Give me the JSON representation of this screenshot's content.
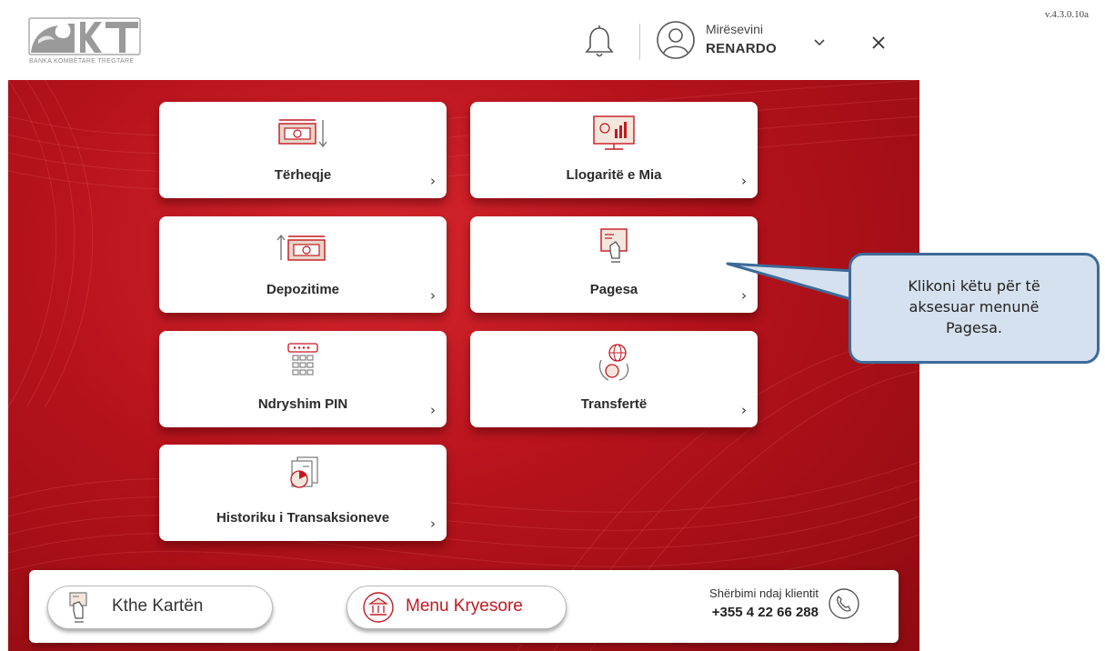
{
  "header": {
    "logo_text": "BKT",
    "logo_subtitle": "BANKA KOMBËTARE TREGTARE",
    "version": "v.4.3.0.10a",
    "greeting": "Mirësevini",
    "username": "RENARDO"
  },
  "menu": [
    {
      "label": "Tërheqje",
      "icon": "cash-withdraw-icon"
    },
    {
      "label": "Llogaritë e Mia",
      "icon": "accounts-monitor-icon"
    },
    {
      "label": "Depozitime",
      "icon": "cash-deposit-icon"
    },
    {
      "label": "Pagesa",
      "icon": "bill-payment-icon"
    },
    {
      "label": "Ndryshim PIN",
      "icon": "pin-keypad-icon"
    },
    {
      "label": "Transfertë",
      "icon": "transfer-globe-icon"
    },
    {
      "label": "Historiku i Transaksioneve",
      "icon": "transaction-history-icon"
    }
  ],
  "card_arrow": "›",
  "bottom": {
    "return_card": "Kthe Kartën",
    "main_menu": "Menu Kryesore",
    "service_label": "Shërbimi ndaj klientit",
    "service_phone": "+355 4 22 66 288"
  },
  "callout": {
    "line1": "Klikoni këtu për të",
    "line2": "aksesuar menunë",
    "line3": "Pagesa."
  },
  "colors": {
    "brand_red": "#c41820",
    "callout_fill": "#d5e1ee",
    "callout_border": "#3d6a98"
  }
}
